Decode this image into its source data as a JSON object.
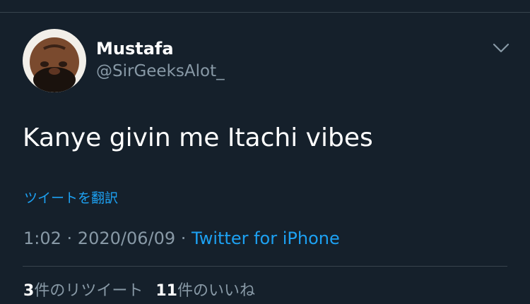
{
  "colors": {
    "background": "#15202b",
    "divider": "#38444d",
    "primary_text": "#ffffff",
    "secondary_text": "#8899a6",
    "link": "#1da1f2"
  },
  "tweet": {
    "author": {
      "display_name": "Mustafa",
      "handle": "@SirGeeksAlot_",
      "avatar_icon": "profile-photo"
    },
    "more_icon": "chevron-down-icon",
    "text": "Kanye givin me Itachi vibes",
    "translate_label": "ツイートを翻訳",
    "time": "1:02",
    "separator": " · ",
    "date": "2020/06/09",
    "source": "Twitter for iPhone",
    "stats": {
      "retweet_count": "3",
      "retweet_label": "件のリツイート",
      "like_count": "11",
      "like_label": "件のいいね"
    }
  }
}
